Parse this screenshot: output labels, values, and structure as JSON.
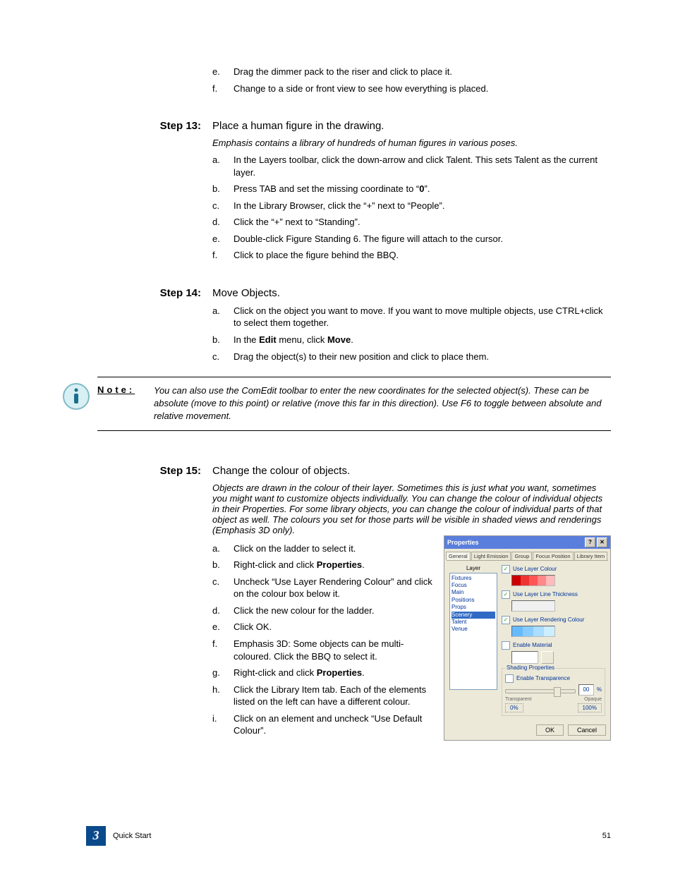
{
  "intro_items": [
    {
      "m": "e.",
      "t": "Drag the dimmer pack to the riser and click to place it."
    },
    {
      "m": "f.",
      "t": "Change to a side or front view to see how everything is placed."
    }
  ],
  "step13": {
    "label": "Step 13:",
    "title": "Place a human figure in the drawing.",
    "note": "Emphasis contains a library of hundreds of human figures in various poses.",
    "items": [
      {
        "m": "a.",
        "t": "In the Layers toolbar, click the down-arrow and click Talent. This sets Talent as the current layer."
      },
      {
        "m": "b.",
        "pre": "Press TAB and set the missing coordinate to “",
        "b": "0",
        "post": "”."
      },
      {
        "m": "c.",
        "t": "In the Library Browser, click the “+” next to “People”."
      },
      {
        "m": "d.",
        "t": "Click the “+” next to “Standing”."
      },
      {
        "m": "e.",
        "t": "Double-click Figure Standing 6. The figure will attach to the cursor."
      },
      {
        "m": "f.",
        "t": "Click to place the figure behind the BBQ."
      }
    ]
  },
  "step14": {
    "label": "Step 14:",
    "title": "Move Objects.",
    "items": [
      {
        "m": "a.",
        "t": "Click on the object you want to move. If you want to move multiple objects, use CTRL+click to select them together."
      },
      {
        "m": "b.",
        "pre": "In the ",
        "b": "Edit",
        "mid": " menu, click ",
        "b2": "Move",
        "post": "."
      },
      {
        "m": "c.",
        "t": "Drag the object(s) to their new position and click to place them."
      }
    ]
  },
  "note": {
    "label": "Note:",
    "text": "You can also use the ComEdit toolbar to enter the new coordinates for the selected object(s). These can be absolute (move to this point) or relative (move this far in this direction). Use F6 to toggle between absolute and relative movement."
  },
  "step15": {
    "label": "Step 15:",
    "title": "Change the colour of objects.",
    "note": "Objects are drawn in the colour of their layer. Sometimes this is just what you want, sometimes you might want to customize objects individually. You can change the colour of individual objects in their Properties. For some library objects, you can change the colour of individual parts of that object as well. The colours you set for those parts will be visible in shaded views and renderings (Emphasis 3D only).",
    "items": [
      {
        "m": "a.",
        "t": "Click on the ladder to select it."
      },
      {
        "m": "b.",
        "pre": "Right-click and click ",
        "b": "Properties",
        "post": "."
      },
      {
        "m": "c.",
        "t": "Uncheck “Use Layer Rendering Colour” and click on the colour box below it."
      },
      {
        "m": "d.",
        "t": "Click the new colour for the ladder."
      },
      {
        "m": "e.",
        "t": "Click OK."
      },
      {
        "m": "f.",
        "t": "Emphasis 3D: Some objects can be multi-coloured. Click the BBQ to select it."
      },
      {
        "m": "g.",
        "pre": "Right-click and click ",
        "b": "Properties",
        "post": "."
      },
      {
        "m": "h.",
        "t": "Click the Library Item tab. Each of the elements listed on the left can have a different colour."
      },
      {
        "m": "i.",
        "t": "Click on an element and uncheck “Use Default Colour”."
      }
    ]
  },
  "dialog": {
    "title": "Properties",
    "tabs": [
      "General",
      "Light Emission",
      "Group",
      "Focus Position",
      "Library Item"
    ],
    "layer_label": "Layer",
    "layers": [
      "Fixtures",
      "Focus",
      "Main",
      "Positions",
      "Props",
      "Scenery",
      "Talent",
      "Venue"
    ],
    "selected_layer": "Scenery",
    "opts": {
      "use_layer_colour": "Use Layer Colour",
      "use_layer_line": "Use Layer Line Thickness",
      "use_layer_render": "Use Layer Rendering Colour",
      "enable_material": "Enable Material",
      "shading": "Shading Properties",
      "enable_trans": "Enable Transparence",
      "transparent": "Transparent",
      "opaque": "Opaque",
      "ok": "OK",
      "cancel": "Cancel",
      "pct": "00",
      "pct_sym": "%"
    }
  },
  "footer": {
    "chapter": "3",
    "section": "Quick Start",
    "page": "51"
  }
}
